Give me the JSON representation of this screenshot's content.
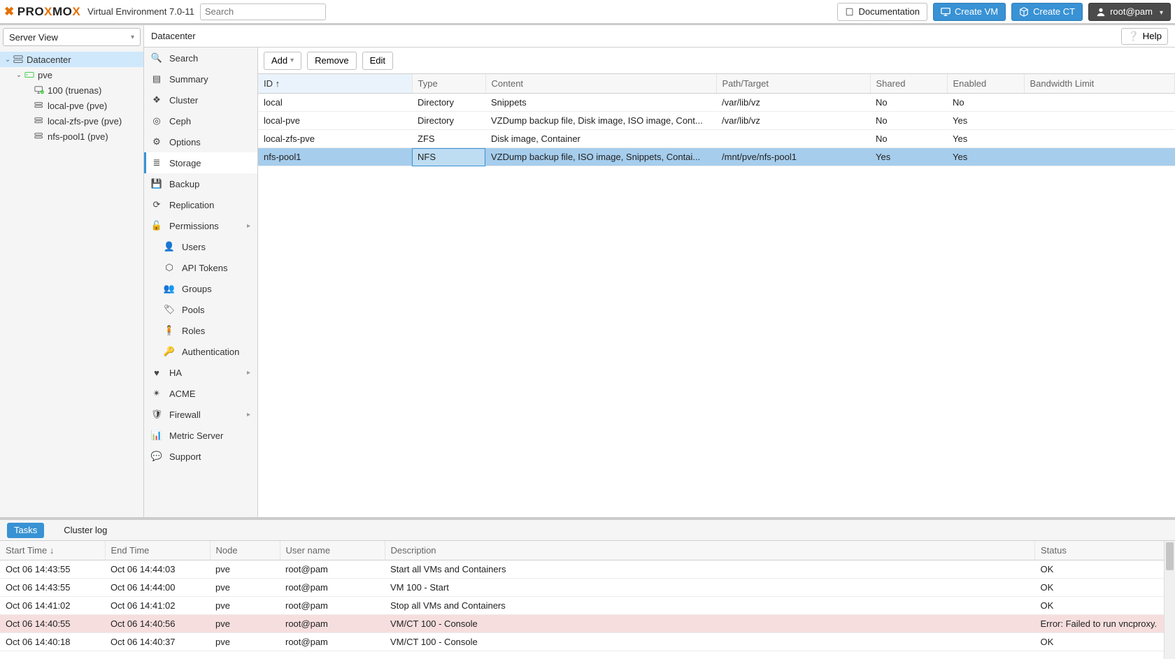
{
  "app": {
    "product": "PROXMOX",
    "title_suffix": "Virtual Environment 7.0-11",
    "search_placeholder": "Search"
  },
  "topbar": {
    "doc_label": "Documentation",
    "create_vm_label": "Create VM",
    "create_ct_label": "Create CT",
    "user_label": "root@pam"
  },
  "tree": {
    "view_selector": "Server View",
    "root_label": "Datacenter",
    "node_label": "pve",
    "children": [
      {
        "label": "100 (truenas)"
      },
      {
        "label": "local-pve (pve)"
      },
      {
        "label": "local-zfs-pve (pve)"
      },
      {
        "label": "nfs-pool1 (pve)"
      }
    ]
  },
  "breadcrumb": {
    "text": "Datacenter",
    "help_label": "Help"
  },
  "config_nav": [
    {
      "label": "Search",
      "icon": "search"
    },
    {
      "label": "Summary",
      "icon": "book"
    },
    {
      "label": "Cluster",
      "icon": "cluster"
    },
    {
      "label": "Ceph",
      "icon": "ceph"
    },
    {
      "label": "Options",
      "icon": "gear"
    },
    {
      "label": "Storage",
      "icon": "storage",
      "selected": true
    },
    {
      "label": "Backup",
      "icon": "save"
    },
    {
      "label": "Replication",
      "icon": "refresh"
    },
    {
      "label": "Permissions",
      "icon": "unlock",
      "expandable": true
    },
    {
      "label": "Users",
      "icon": "user",
      "sub": true
    },
    {
      "label": "API Tokens",
      "icon": "token",
      "sub": true
    },
    {
      "label": "Groups",
      "icon": "group",
      "sub": true
    },
    {
      "label": "Pools",
      "icon": "tag",
      "sub": true
    },
    {
      "label": "Roles",
      "icon": "role",
      "sub": true
    },
    {
      "label": "Authentication",
      "icon": "key",
      "sub": true
    },
    {
      "label": "HA",
      "icon": "heart",
      "expandable": true
    },
    {
      "label": "ACME",
      "icon": "cert"
    },
    {
      "label": "Firewall",
      "icon": "shield",
      "expandable": true
    },
    {
      "label": "Metric Server",
      "icon": "chart"
    },
    {
      "label": "Support",
      "icon": "chat"
    }
  ],
  "toolbar": {
    "add_label": "Add",
    "remove_label": "Remove",
    "edit_label": "Edit"
  },
  "storage": {
    "columns": [
      "ID ↑",
      "Type",
      "Content",
      "Path/Target",
      "Shared",
      "Enabled",
      "Bandwidth Limit"
    ],
    "col_widths": [
      "220px",
      "105px",
      "330px",
      "220px",
      "110px",
      "110px",
      "auto"
    ],
    "rows": [
      {
        "id": "local",
        "type": "Directory",
        "content": "Snippets",
        "path": "/var/lib/vz",
        "shared": "No",
        "enabled": "No",
        "bw": ""
      },
      {
        "id": "local-pve",
        "type": "Directory",
        "content": "VZDump backup file, Disk image, ISO image, Cont...",
        "path": "/var/lib/vz",
        "shared": "No",
        "enabled": "Yes",
        "bw": ""
      },
      {
        "id": "local-zfs-pve",
        "type": "ZFS",
        "content": "Disk image, Container",
        "path": "",
        "shared": "No",
        "enabled": "Yes",
        "bw": ""
      },
      {
        "id": "nfs-pool1",
        "type": "NFS",
        "content": "VZDump backup file, ISO image, Snippets, Contai...",
        "path": "/mnt/pve/nfs-pool1",
        "shared": "Yes",
        "enabled": "Yes",
        "bw": "",
        "selected": true
      }
    ]
  },
  "logs": {
    "tabs": {
      "tasks": "Tasks",
      "cluster": "Cluster log"
    },
    "columns": [
      "Start Time ↓",
      "End Time",
      "Node",
      "User name",
      "Description",
      "Status"
    ],
    "col_widths": [
      "150px",
      "150px",
      "100px",
      "150px",
      "auto",
      "200px"
    ],
    "rows": [
      {
        "start": "Oct 06 14:43:55",
        "end": "Oct 06 14:44:03",
        "node": "pve",
        "user": "root@pam",
        "desc": "Start all VMs and Containers",
        "status": "OK"
      },
      {
        "start": "Oct 06 14:43:55",
        "end": "Oct 06 14:44:00",
        "node": "pve",
        "user": "root@pam",
        "desc": "VM 100 - Start",
        "status": "OK"
      },
      {
        "start": "Oct 06 14:41:02",
        "end": "Oct 06 14:41:02",
        "node": "pve",
        "user": "root@pam",
        "desc": "Stop all VMs and Containers",
        "status": "OK"
      },
      {
        "start": "Oct 06 14:40:55",
        "end": "Oct 06 14:40:56",
        "node": "pve",
        "user": "root@pam",
        "desc": "VM/CT 100 - Console",
        "status": "Error: Failed to run vncproxy.",
        "error": true
      },
      {
        "start": "Oct 06 14:40:18",
        "end": "Oct 06 14:40:37",
        "node": "pve",
        "user": "root@pam",
        "desc": "VM/CT 100 - Console",
        "status": "OK"
      }
    ]
  }
}
